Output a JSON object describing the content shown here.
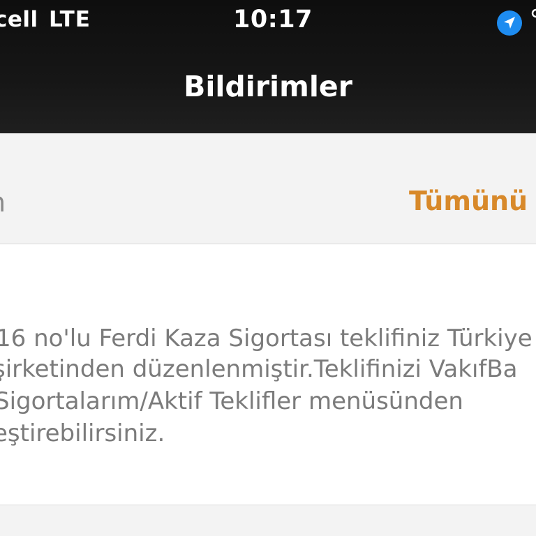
{
  "status_bar": {
    "carrier": "cell",
    "network": "LTE",
    "time": "10:17",
    "location_icon": "location-arrow-icon"
  },
  "nav": {
    "title": "Bildirimler"
  },
  "toolbar": {
    "left_partial": "n",
    "mark_all_label": "Tümünü T"
  },
  "notification": {
    "lines": [
      "16 no'lu Ferdi Kaza Sigortası teklifiniz Türkiye",
      "şirketinden düzenlenmiştir.Teklifinizi VakıfBa",
      "Sigortalarım/Aktif Teklifler menüsünden",
      "eştirebilirsiniz."
    ]
  },
  "colors": {
    "header_bg": "#111111",
    "accent": "#d8892a",
    "location_blue": "#1e8cf0",
    "body_text": "#7b7b7b"
  }
}
